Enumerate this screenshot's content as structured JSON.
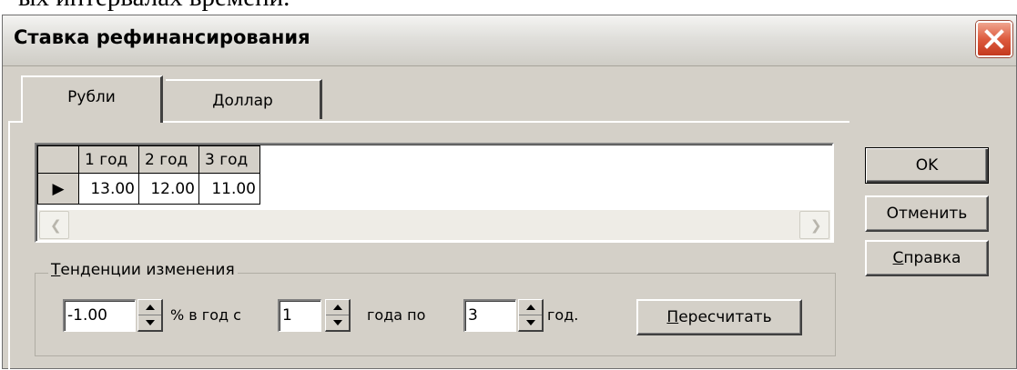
{
  "document": {
    "text": "ых интервалах времени."
  },
  "window": {
    "title": "Ставка рефинансирования"
  },
  "tabs": [
    {
      "label": "Рубли",
      "active": true
    },
    {
      "label": "Доллар",
      "active": false
    }
  ],
  "grid": {
    "columns": [
      "1 год",
      "2 год",
      "3 год"
    ],
    "row": {
      "indicator": "▶",
      "values": [
        "13.00",
        "12.00",
        "11.00"
      ]
    }
  },
  "buttons": {
    "ok": "OK",
    "cancel": "Отменить",
    "help_underline": "С",
    "help_rest": "правка"
  },
  "trend": {
    "legend_underline": "Т",
    "legend_rest": "енденции изменения",
    "rate_value": "-1.00",
    "label_percent": "% в год  с",
    "from_value": "1",
    "label_from": "года  по",
    "to_value": "3",
    "label_to": "год.",
    "recalc_underline": "П",
    "recalc_rest": "ересчитать"
  }
}
